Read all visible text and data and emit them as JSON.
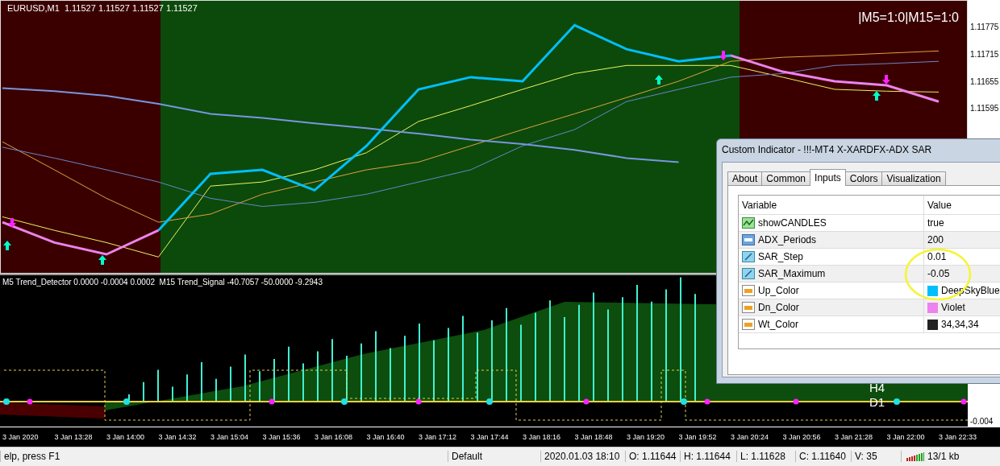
{
  "chart": {
    "header": "EURUSD,M1  1.11527 1.11527 1.11527 1.11527",
    "signal_label": "|M5=1:0|M15=1:0",
    "zones": [
      {
        "kind": "down"
      },
      {
        "kind": "up"
      },
      {
        "kind": "down"
      }
    ],
    "chart_data": {
      "type": "line",
      "ylim": [
        1.11232,
        1.11834
      ],
      "yticks": [
        1.11595,
        1.11655,
        1.11715,
        1.11775
      ],
      "series": [
        {
          "color": "#ee82ee",
          "values": [
            1.11344,
            1.11299,
            1.11273,
            1.11326,
            null,
            null,
            null,
            null,
            null,
            null,
            null,
            null,
            null,
            null,
            1.11713,
            1.11677,
            1.11656,
            1.11647,
            1.11611
          ]
        },
        {
          "color": "#00bfff",
          "values": [
            null,
            null,
            null,
            1.11326,
            1.11451,
            1.1146,
            1.11415,
            1.11513,
            1.11638,
            1.11665,
            1.11656,
            1.1178,
            1.11727,
            1.117,
            1.11713,
            null,
            null,
            null,
            null
          ]
        },
        {
          "color": "#7a95e0",
          "values": [
            1.11641,
            1.11634,
            1.11624,
            1.11606,
            1.11584,
            1.11575,
            1.11563,
            1.11552,
            1.1154,
            1.11527,
            1.11517,
            1.11504,
            1.11486,
            1.11477,
            null,
            null,
            null,
            null,
            null
          ]
        },
        {
          "color": "#6a85c8",
          "values": [
            1.1151,
            1.11486,
            1.1146,
            1.11433,
            1.11397,
            1.11379,
            1.11388,
            1.11406,
            1.11433,
            1.1146,
            1.11513,
            1.11549,
            1.11611,
            1.11638,
            1.11665,
            1.11673,
            1.11691,
            1.11695,
            1.117
          ]
        },
        {
          "color": "#e0a040",
          "values": [
            1.11522,
            1.1146,
            1.11397,
            1.11344,
            1.11362,
            1.11406,
            1.11433,
            1.1146,
            1.11477,
            1.11513,
            1.11549,
            1.11584,
            1.1162,
            1.11656,
            1.117,
            1.11709,
            1.11713,
            1.11718,
            1.11723
          ]
        },
        {
          "color": "#f0f060",
          "values": [
            1.11356,
            1.11326,
            1.11299,
            1.11267,
            1.11424,
            1.11433,
            1.1146,
            1.11498,
            1.11567,
            1.11602,
            1.11638,
            1.11673,
            1.11691,
            1.11691,
            1.11691,
            1.11665,
            1.11638,
            1.11634,
            1.11632
          ]
        }
      ]
    }
  },
  "indicator": {
    "header": "M5 Trend_Detector 0.0000 -0.0004 0.0002  M15 Trend_Signal -40.7057 -50.0000 -9.2943",
    "markers": [
      "H4",
      "D1"
    ],
    "axis_label": "-0.004"
  },
  "time_axis": [
    "3 Jan 2020",
    "3 Jan 13:28",
    "3 Jan 14:00",
    "3 Jan 14:32",
    "3 Jan 15:04",
    "3 Jan 15:36",
    "3 Jan 16:08",
    "3 Jan 16:40",
    "3 Jan 17:12",
    "3 Jan 17:44",
    "3 Jan 18:16",
    "3 Jan 18:48",
    "3 Jan 19:20",
    "3 Jan 19:52",
    "3 Jan 20:24",
    "3 Jan 20:56",
    "3 Jan 21:28",
    "3 Jan 22:00",
    "3 Jan 22:33"
  ],
  "dialog": {
    "title": "Custom Indicator - !!!-MT4 X-XARDFX-ADX SAR",
    "tabs": [
      {
        "label": "About",
        "selected": false
      },
      {
        "label": "Common",
        "selected": false
      },
      {
        "label": "Inputs",
        "selected": true
      },
      {
        "label": "Colors",
        "selected": false
      },
      {
        "label": "Visualization",
        "selected": false
      }
    ],
    "columns": [
      "Variable",
      "Value"
    ],
    "rows": [
      {
        "kind": "bool",
        "name": "showCANDLES",
        "value": "true"
      },
      {
        "kind": "int",
        "name": "ADX_Periods",
        "value": "200"
      },
      {
        "kind": "double",
        "name": "SAR_Step",
        "value": "0.01"
      },
      {
        "kind": "double",
        "name": "SAR_Maximum",
        "value": "-0.05"
      },
      {
        "kind": "color",
        "name": "Up_Color",
        "value": "DeepSkyBlue",
        "color": "#00bfff"
      },
      {
        "kind": "color",
        "name": "Dn_Color",
        "value": "Violet",
        "color": "#ee82ee"
      },
      {
        "kind": "color",
        "name": "Wt_Color",
        "value": "34,34,34",
        "color": "#222222"
      }
    ]
  },
  "status_bar": [
    "elp, press F1",
    "Default",
    "2020.01.03 18:10",
    "O: 1.11644",
    "H: 1.11644",
    "L: 1.11628",
    "C: 1.11640",
    "V: 35",
    "13/1 kb"
  ]
}
